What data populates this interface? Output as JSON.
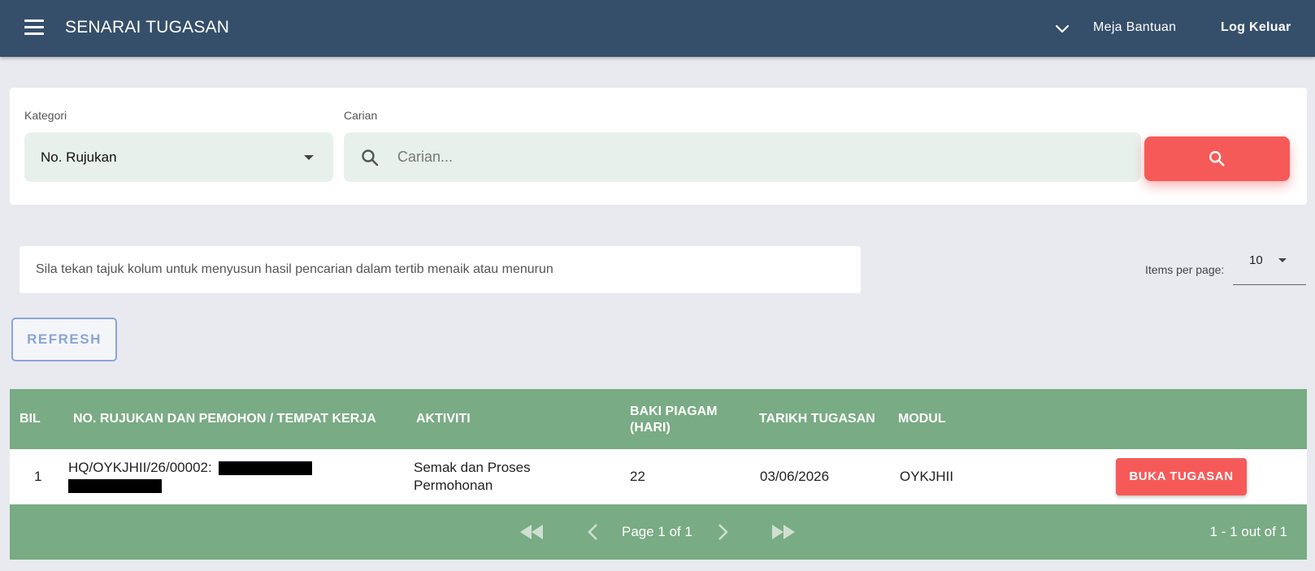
{
  "header": {
    "title": "SENARAI TUGASAN",
    "help_label": "Meja Bantuan",
    "logout_label": "Log Keluar"
  },
  "search": {
    "category_label": "Kategori",
    "category_value": "No. Rujukan",
    "query_label": "Carian",
    "query_placeholder": "Carian...",
    "query_value": ""
  },
  "hint": {
    "text": "Sila tekan tajuk kolum untuk menyusun hasil pencarian dalam tertib menaik atau menurun"
  },
  "pagination": {
    "items_per_page_label": "Items per page:",
    "items_per_page_value": "10",
    "page_info": "Page 1 of 1",
    "range_info": "1 - 1 out of 1"
  },
  "refresh_label": "REFRESH",
  "table": {
    "columns": {
      "bil": "BIL",
      "ref": "NO. RUJUKAN DAN PEMOHON / TEMPAT KERJA",
      "activity": "AKTIVITI",
      "charter_line1": "BAKI PIAGAM",
      "charter_line2": "(HARI)",
      "date": "TARIKH TUGASAN",
      "module": "MODUL"
    },
    "rows": [
      {
        "bil": "1",
        "ref": "HQ/OYKJHII/26/00002:",
        "activity": "Semak dan Proses Permohonan",
        "charter_days": "22",
        "date": "03/06/2026",
        "module": "OYKJHII",
        "action_label": "BUKA TUGASAN"
      }
    ]
  },
  "colors": {
    "topbar": "#354f6a",
    "accent": "#f65a58",
    "table_green": "#79ab84",
    "input_bg": "#e8f0ec",
    "refresh_blue": "#8aa5d8"
  }
}
